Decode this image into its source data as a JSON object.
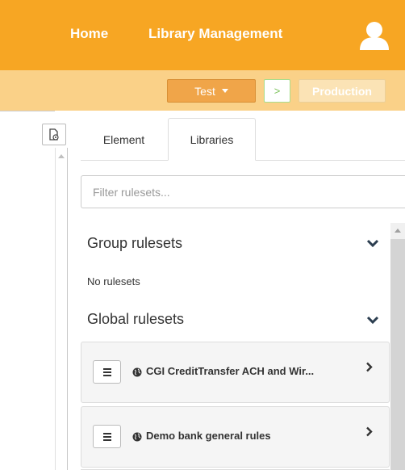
{
  "nav": {
    "home": "Home",
    "library_management": "Library Management"
  },
  "env": {
    "test_label": "Test",
    "promote_label": ">",
    "production_label": "Production"
  },
  "tabs": [
    {
      "label": "Element"
    },
    {
      "label": "Libraries"
    }
  ],
  "filter": {
    "placeholder": "Filter rulesets..."
  },
  "sections": {
    "group_title": "Group rulesets",
    "group_empty": "No rulesets",
    "global_title": "Global rulesets"
  },
  "rulesets": [
    {
      "label": "CGI CreditTransfer ACH and Wir..."
    },
    {
      "label": "Demo bank general rules"
    }
  ],
  "colors": {
    "nav_bg": "#f7a623",
    "env_bg": "#fad188",
    "test_button": "#f0a549",
    "promote_border": "#a7dd8c"
  },
  "icons": {
    "user": "user-icon",
    "document_settings": "document-gear-icon",
    "chevron_down": "chevron-down-icon",
    "chevron_right": "chevron-right-icon",
    "menu": "hamburger-icon",
    "globe": "globe-icon"
  }
}
